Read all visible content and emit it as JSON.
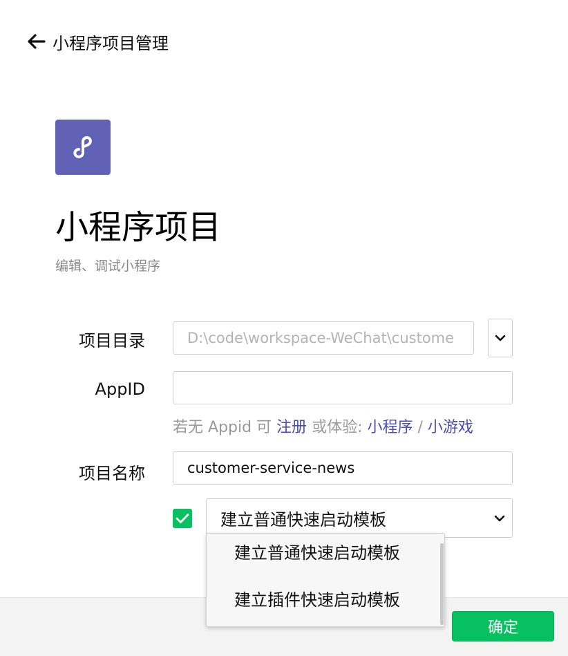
{
  "header": {
    "title": "小程序项目管理",
    "back_icon": "arrow-left-icon"
  },
  "logo": {
    "icon": "mini-program-link-icon",
    "color": "#6161b6"
  },
  "page": {
    "title": "小程序项目",
    "subtitle": "编辑、调试小程序"
  },
  "form": {
    "dir_label": "项目目录",
    "dir_value": "D:\\code\\workspace-WeChat\\custome",
    "appid_label": "AppID",
    "appid_value": "",
    "hint_prefix": "若无 Appid 可",
    "hint_register": "注册",
    "hint_middle": "或体验:",
    "hint_miniprogram": "小程序",
    "hint_sep": "/",
    "hint_minigame": "小游戏",
    "name_label": "项目名称",
    "name_value": "customer-service-news",
    "template_checked": true,
    "template_selected": "建立普通快速启动模板"
  },
  "dropdown": {
    "options": [
      "建立普通快速启动模板",
      "建立插件快速启动模板"
    ]
  },
  "footer": {
    "confirm_label": "确定"
  },
  "colors": {
    "accent": "#07c160",
    "link": "#4b4bb7",
    "brand": "#6161b6"
  }
}
